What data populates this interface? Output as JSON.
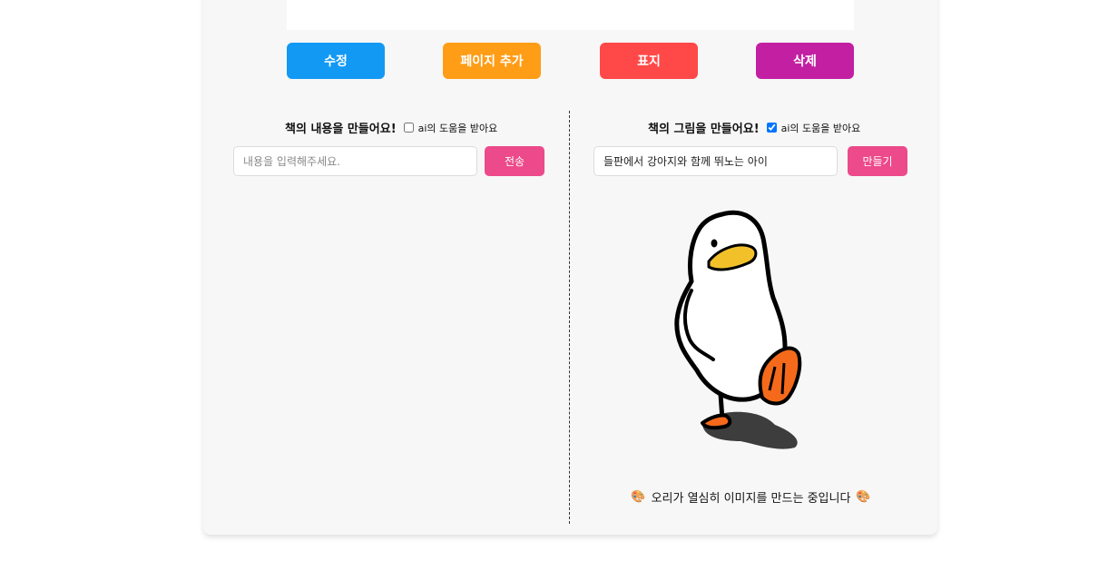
{
  "toolbar": {
    "edit_label": "수정",
    "add_page_label": "페이지 추가",
    "cover_label": "표지",
    "delete_label": "삭제",
    "colors": {
      "edit": "#1199f4",
      "add_page": "#ff9d17",
      "cover": "#ff4848",
      "delete": "#c31fa3"
    }
  },
  "content_panel": {
    "heading": "책의 내용을 만들어요!",
    "ai_help_label": "ai의 도움을 받아요",
    "ai_help_checked": false,
    "input_placeholder": "내용을 입력해주세요.",
    "input_value": "",
    "submit_label": "전송"
  },
  "image_panel": {
    "heading": "책의 그림을 만들어요!",
    "ai_help_label": "ai의 도움을 받아요",
    "ai_help_checked": true,
    "input_value": "들판에서 강아지와 함께 뛰노는 아이",
    "create_label": "만들기",
    "status_text": "오리가 열심히 이미지를 만드는 중입니다",
    "status_icon": "palette-icon",
    "loading_icon": "duck-icon"
  }
}
